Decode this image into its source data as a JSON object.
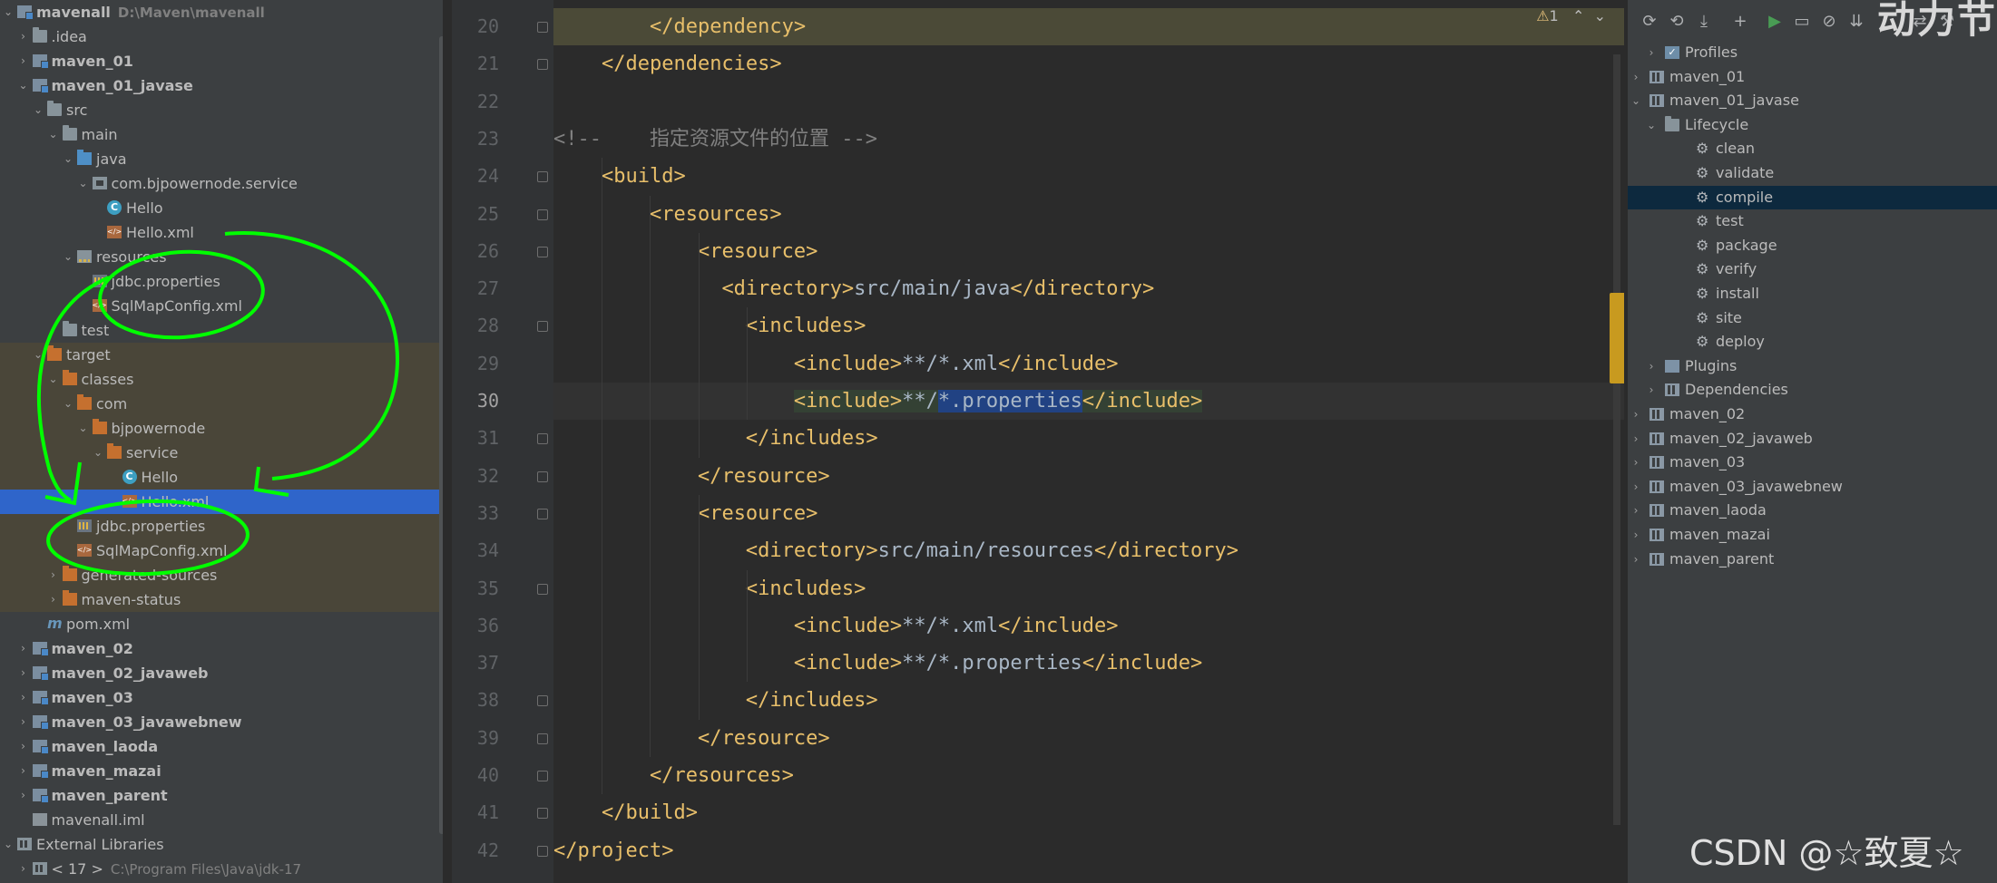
{
  "project_tree": {
    "rows": [
      {
        "label": "mavenall",
        "hint": "D:\\Maven\\mavenall",
        "icon": "module",
        "indent": 0,
        "arrow": "v",
        "bold": true
      },
      {
        "label": ".idea",
        "icon": "folder",
        "indent": 1,
        "arrow": ">"
      },
      {
        "label": "maven_01",
        "icon": "module",
        "indent": 1,
        "arrow": ">",
        "bold": true
      },
      {
        "label": "maven_01_javase",
        "icon": "module",
        "indent": 1,
        "arrow": "v",
        "bold": true
      },
      {
        "label": "src",
        "icon": "folder",
        "indent": 2,
        "arrow": "v"
      },
      {
        "label": "main",
        "icon": "folder",
        "indent": 3,
        "arrow": "v"
      },
      {
        "label": "java",
        "icon": "src",
        "indent": 4,
        "arrow": "v"
      },
      {
        "label": "com.bjpowernode.service",
        "icon": "pkg",
        "indent": 5,
        "arrow": "v"
      },
      {
        "label": "Hello",
        "icon": "cls",
        "indent": 6,
        "arrow": ""
      },
      {
        "label": "Hello.xml",
        "icon": "xml",
        "indent": 6,
        "arrow": ""
      },
      {
        "label": "resources",
        "icon": "res",
        "indent": 4,
        "arrow": "v"
      },
      {
        "label": "jdbc.properties",
        "icon": "props",
        "indent": 5,
        "arrow": ""
      },
      {
        "label": "SqlMapConfig.xml",
        "icon": "xml",
        "indent": 5,
        "arrow": ""
      },
      {
        "label": "test",
        "icon": "folder",
        "indent": 3,
        "arrow": ">"
      },
      {
        "label": "target",
        "icon": "orange",
        "indent": 2,
        "arrow": "v",
        "excluded": true
      },
      {
        "label": "classes",
        "icon": "orange",
        "indent": 3,
        "arrow": "v",
        "excluded": true
      },
      {
        "label": "com",
        "icon": "orange",
        "indent": 4,
        "arrow": "v",
        "excluded": true
      },
      {
        "label": "bjpowernode",
        "icon": "orange",
        "indent": 5,
        "arrow": "v",
        "excluded": true
      },
      {
        "label": "service",
        "icon": "orange",
        "indent": 6,
        "arrow": "v",
        "excluded": true
      },
      {
        "label": "Hello",
        "icon": "cls",
        "indent": 7,
        "arrow": "",
        "excluded": true
      },
      {
        "label": "Hello.xml",
        "icon": "xml",
        "indent": 7,
        "arrow": "",
        "excluded": true,
        "selected": true
      },
      {
        "label": "jdbc.properties",
        "icon": "props",
        "indent": 4,
        "arrow": "",
        "excluded": true
      },
      {
        "label": "SqlMapConfig.xml",
        "icon": "xml",
        "indent": 4,
        "arrow": "",
        "excluded": true
      },
      {
        "label": "generated-sources",
        "icon": "orange",
        "indent": 3,
        "arrow": ">",
        "excluded": true
      },
      {
        "label": "maven-status",
        "icon": "orange",
        "indent": 3,
        "arrow": ">",
        "excluded": true
      },
      {
        "label": "pom.xml",
        "icon": "pom",
        "indent": 2,
        "arrow": ""
      },
      {
        "label": "maven_02",
        "icon": "module",
        "indent": 1,
        "arrow": ">",
        "bold": true
      },
      {
        "label": "maven_02_javaweb",
        "icon": "module",
        "indent": 1,
        "arrow": ">",
        "bold": true
      },
      {
        "label": "maven_03",
        "icon": "module",
        "indent": 1,
        "arrow": ">",
        "bold": true
      },
      {
        "label": "maven_03_javawebnew",
        "icon": "module",
        "indent": 1,
        "arrow": ">",
        "bold": true
      },
      {
        "label": "maven_laoda",
        "icon": "module",
        "indent": 1,
        "arrow": ">",
        "bold": true
      },
      {
        "label": "maven_mazai",
        "icon": "module",
        "indent": 1,
        "arrow": ">",
        "bold": true
      },
      {
        "label": "maven_parent",
        "icon": "module",
        "indent": 1,
        "arrow": ">",
        "bold": true
      },
      {
        "label": "mavenall.iml",
        "icon": "iml",
        "indent": 1,
        "arrow": ""
      },
      {
        "label": "External Libraries",
        "icon": "lib",
        "indent": 0,
        "arrow": "v"
      },
      {
        "label": "< 17 >",
        "hint": "C:\\Program Files\\Java\\jdk-17",
        "icon": "lib",
        "indent": 1,
        "arrow": ">"
      }
    ]
  },
  "editor": {
    "warning_count": "1",
    "current_line": 30,
    "lines": [
      {
        "n": "20",
        "indent": 4,
        "parts": [
          [
            "tag",
            "</dependency>"
          ]
        ],
        "top": true
      },
      {
        "n": "21",
        "indent": 2,
        "parts": [
          [
            "tag",
            "</dependencies>"
          ]
        ]
      },
      {
        "n": "22",
        "indent": 0,
        "parts": []
      },
      {
        "n": "23",
        "indent": 0,
        "parts": [
          [
            "cmt",
            "<!--    指定资源文件的位置 -->"
          ]
        ]
      },
      {
        "n": "24",
        "indent": 2,
        "parts": [
          [
            "tag",
            "<build>"
          ]
        ]
      },
      {
        "n": "25",
        "indent": 4,
        "parts": [
          [
            "tag",
            "<resources>"
          ]
        ]
      },
      {
        "n": "26",
        "indent": 6,
        "parts": [
          [
            "tag",
            "<resource>"
          ]
        ]
      },
      {
        "n": "27",
        "indent": 7,
        "parts": [
          [
            "tag",
            "<directory>"
          ],
          [
            "txt",
            "src/main/java"
          ],
          [
            "tag",
            "</directory>"
          ]
        ]
      },
      {
        "n": "28",
        "indent": 8,
        "parts": [
          [
            "tag",
            "<includes>"
          ]
        ]
      },
      {
        "n": "29",
        "indent": 10,
        "parts": [
          [
            "tag",
            "<include>"
          ],
          [
            "txt",
            "**/*.xml"
          ],
          [
            "tag",
            "</include>"
          ]
        ]
      },
      {
        "n": "30",
        "indent": 10,
        "parts": [
          [
            "tag hl",
            "<include>"
          ],
          [
            "txt hl",
            "**/"
          ],
          [
            "txt sel",
            "*.properties"
          ],
          [
            "tag hl",
            "</include>"
          ]
        ]
      },
      {
        "n": "31",
        "indent": 8,
        "parts": [
          [
            "tag",
            "</includes>"
          ]
        ]
      },
      {
        "n": "32",
        "indent": 6,
        "parts": [
          [
            "tag",
            "</resource>"
          ]
        ]
      },
      {
        "n": "33",
        "indent": 6,
        "parts": [
          [
            "tag",
            "<resource>"
          ]
        ]
      },
      {
        "n": "34",
        "indent": 8,
        "parts": [
          [
            "tag",
            "<directory>"
          ],
          [
            "txt",
            "src/main/resources"
          ],
          [
            "tag",
            "</directory>"
          ]
        ]
      },
      {
        "n": "35",
        "indent": 8,
        "parts": [
          [
            "tag",
            "<includes>"
          ]
        ]
      },
      {
        "n": "36",
        "indent": 10,
        "parts": [
          [
            "tag",
            "<include>"
          ],
          [
            "txt",
            "**/*.xml"
          ],
          [
            "tag",
            "</include>"
          ]
        ]
      },
      {
        "n": "37",
        "indent": 10,
        "parts": [
          [
            "tag",
            "<include>"
          ],
          [
            "txt",
            "**/*.properties"
          ],
          [
            "tag",
            "</include>"
          ]
        ]
      },
      {
        "n": "38",
        "indent": 8,
        "parts": [
          [
            "tag",
            "</includes>"
          ]
        ]
      },
      {
        "n": "39",
        "indent": 6,
        "parts": [
          [
            "tag",
            "</resource>"
          ]
        ]
      },
      {
        "n": "40",
        "indent": 4,
        "parts": [
          [
            "tag",
            "</resources>"
          ]
        ]
      },
      {
        "n": "41",
        "indent": 2,
        "parts": [
          [
            "tag",
            "</build>"
          ]
        ]
      },
      {
        "n": "42",
        "indent": 0,
        "parts": [
          [
            "tag",
            "</project>"
          ]
        ]
      }
    ]
  },
  "maven_panel": {
    "toolbar_icons": [
      "refresh-icon",
      "reimport-icon",
      "download-icon",
      "add-icon",
      "run-icon",
      "toggle-offline-icon",
      "skip-tests-icon",
      "collapse-icon",
      "show-deps-icon",
      "settings-icon"
    ],
    "rows": [
      {
        "label": "Profiles",
        "icon": "check",
        "indent": 1,
        "arrow": ">"
      },
      {
        "label": "maven_01",
        "icon": "mproj",
        "indent": 0,
        "arrow": ">"
      },
      {
        "label": "maven_01_javase",
        "icon": "mproj",
        "indent": 0,
        "arrow": "v"
      },
      {
        "label": "Lifecycle",
        "icon": "folder",
        "indent": 1,
        "arrow": "v"
      },
      {
        "label": "clean",
        "icon": "gear",
        "indent": 3,
        "arrow": ""
      },
      {
        "label": "validate",
        "icon": "gear",
        "indent": 3,
        "arrow": ""
      },
      {
        "label": "compile",
        "icon": "gear",
        "indent": 3,
        "arrow": "",
        "selected": true
      },
      {
        "label": "test",
        "icon": "gear",
        "indent": 3,
        "arrow": ""
      },
      {
        "label": "package",
        "icon": "gear",
        "indent": 3,
        "arrow": ""
      },
      {
        "label": "verify",
        "icon": "gear",
        "indent": 3,
        "arrow": ""
      },
      {
        "label": "install",
        "icon": "gear",
        "indent": 3,
        "arrow": ""
      },
      {
        "label": "site",
        "icon": "gear",
        "indent": 3,
        "arrow": ""
      },
      {
        "label": "deploy",
        "icon": "gear",
        "indent": 3,
        "arrow": ""
      },
      {
        "label": "Plugins",
        "icon": "plug",
        "indent": 1,
        "arrow": ">"
      },
      {
        "label": "Dependencies",
        "icon": "mproj",
        "indent": 1,
        "arrow": ">"
      },
      {
        "label": "maven_02",
        "icon": "mproj",
        "indent": 0,
        "arrow": ">"
      },
      {
        "label": "maven_02_javaweb",
        "icon": "mproj",
        "indent": 0,
        "arrow": ">"
      },
      {
        "label": "maven_03",
        "icon": "mproj",
        "indent": 0,
        "arrow": ">"
      },
      {
        "label": "maven_03_javawebnew",
        "icon": "mproj",
        "indent": 0,
        "arrow": ">"
      },
      {
        "label": "maven_laoda",
        "icon": "mproj",
        "indent": 0,
        "arrow": ">"
      },
      {
        "label": "maven_mazai",
        "icon": "mproj",
        "indent": 0,
        "arrow": ">"
      },
      {
        "label": "maven_parent",
        "icon": "mproj",
        "indent": 0,
        "arrow": ">"
      }
    ]
  },
  "watermark": "CSDN @☆致夏☆",
  "corner_text": "动力节",
  "colors": {
    "annotation": "#00ff00",
    "selection": "#2f65ca",
    "tag": "#e8bf6a"
  }
}
